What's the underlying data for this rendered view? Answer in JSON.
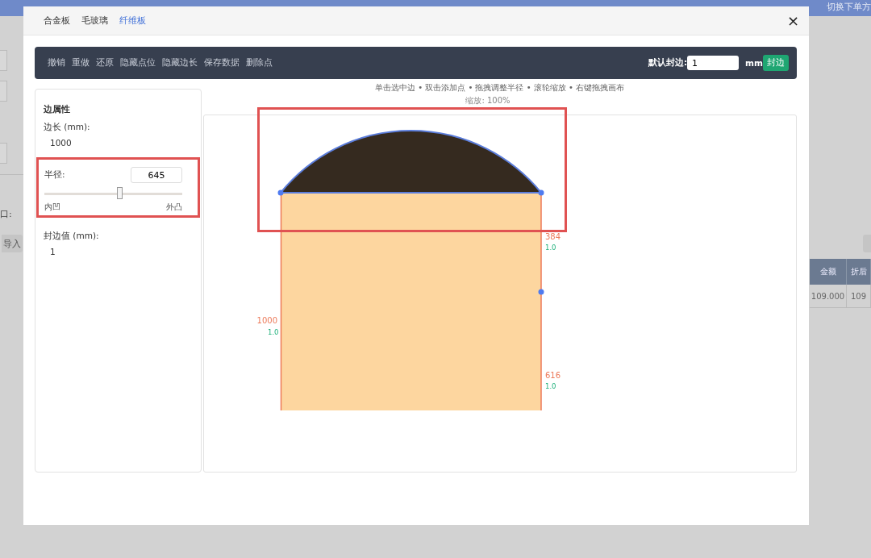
{
  "backdrop": {
    "top_bar_text": "切换下单方",
    "field_label": "口:",
    "button": "导入",
    "table": {
      "columns": [
        "金额",
        "折后"
      ],
      "rows": [
        [
          "109.000",
          "109"
        ]
      ]
    }
  },
  "dialog": {
    "tabs": [
      {
        "label": "合金板",
        "selected": false
      },
      {
        "label": "毛玻璃",
        "selected": false
      },
      {
        "label": "纤维板",
        "selected": true
      }
    ],
    "close": "×"
  },
  "toolbar": {
    "actions": [
      "撤销",
      "重做",
      "还原",
      "隐藏点位",
      "隐藏边长",
      "保存数据",
      "删除点"
    ],
    "default_edge_label": "默认封边:",
    "default_edge_value": "1",
    "unit": "mm",
    "apply_button": "封边"
  },
  "properties": {
    "title": "边属性",
    "length_label": "边长 (mm):",
    "length_value": "1000",
    "radius": {
      "label": "半径:",
      "value": "645",
      "level": 0.55,
      "min_label": "内凹",
      "max_label": "外凸",
      "highlighted": true
    },
    "edge_band_label": "封边值 (mm):",
    "edge_band_value": "1"
  },
  "canvas": {
    "hint": "单击选中边 • 双击添加点 • 拖拽调整半径 • 滚轮缩放 • 右键拖拽画布",
    "zoom": "缩放: 100%",
    "arc": {
      "selected": true,
      "highlighted": true
    },
    "edge_labels": [
      {
        "length": "1000",
        "band": "1.0"
      },
      {
        "length": "384",
        "band": "1.0"
      },
      {
        "length": "616",
        "band": "1.0"
      }
    ]
  }
}
